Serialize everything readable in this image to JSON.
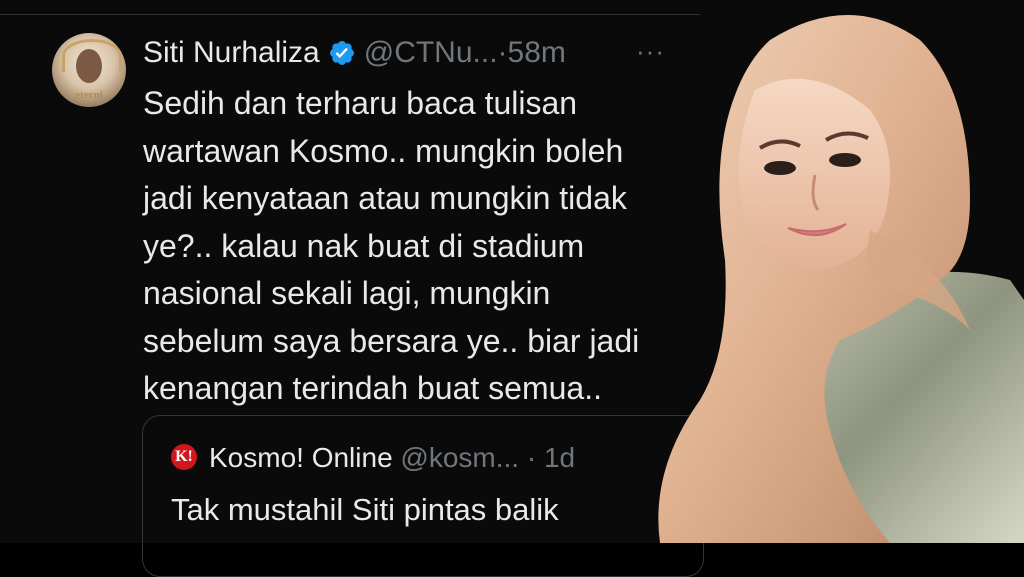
{
  "tweet": {
    "display_name": "Siti Nurhaliza",
    "handle": "@CTNu...",
    "separator": "·",
    "time": "58m",
    "more": "···",
    "avatar_badge": "eterni",
    "body_lines": [
      "Sedih dan terharu baca tulisan",
      "wartawan Kosmo.. mungkin boleh",
      "jadi kenyataan atau mungkin tidak",
      "ye?.. kalau nak buat di stadium",
      "nasional sekali lagi, mungkin",
      "sebelum saya bersara ye.. biar jadi",
      "kenangan terindah buat semua.."
    ]
  },
  "quoted": {
    "logo_text": "K!",
    "display_name": "Kosmo! Online",
    "handle": "@kosm...",
    "separator": "·",
    "time": "1d",
    "text": "Tak mustahil Siti pintas balik"
  },
  "colors": {
    "background": "#0a0a0a",
    "text_primary": "#e7e9ea",
    "text_secondary": "#71767b",
    "verified_blue": "#1d9bf0",
    "kosmo_red": "#d1161c"
  },
  "icons": {
    "verified": "verified-badge-icon",
    "more": "more-icon"
  }
}
